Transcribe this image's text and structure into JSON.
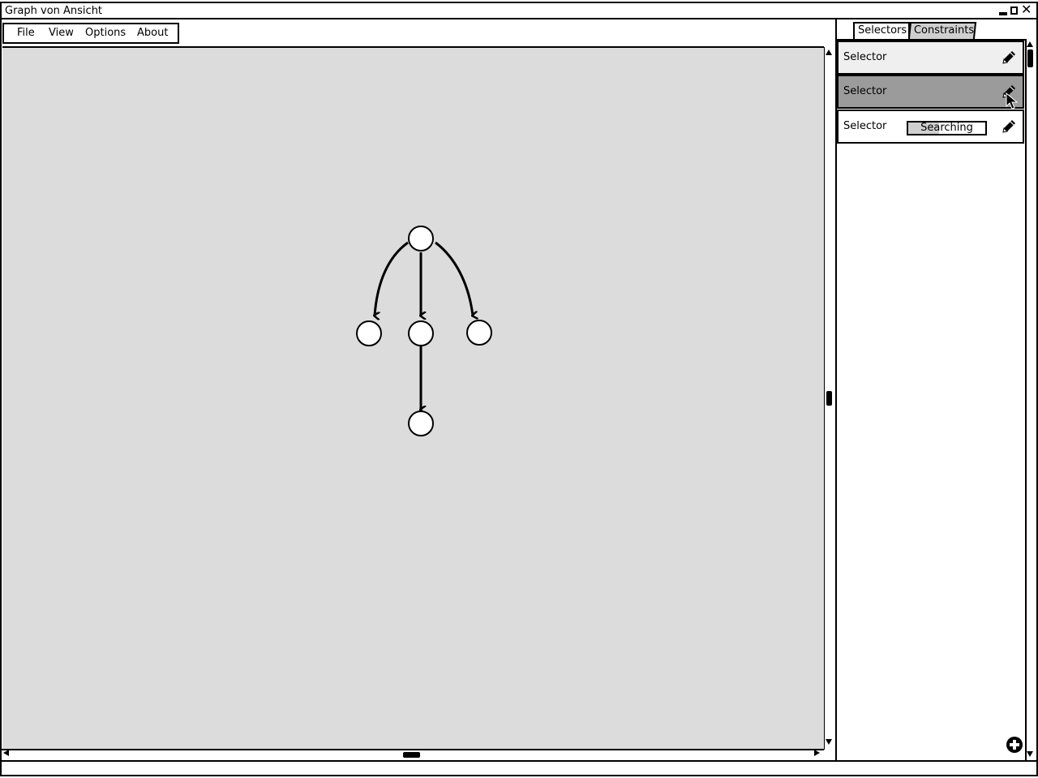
{
  "window": {
    "title": "Graph von Ansicht"
  },
  "menu": {
    "items": [
      "File",
      "View",
      "Options",
      "About"
    ]
  },
  "panel": {
    "tabs": [
      {
        "label": "Selectors",
        "active": true
      },
      {
        "label": "Constraints",
        "active": false
      }
    ],
    "selectors": [
      {
        "label": "Selector",
        "state": "normal",
        "action_icon": "pencil-icon"
      },
      {
        "label": "Selector",
        "state": "hovered",
        "action_icon": "pencil-icon"
      },
      {
        "label": "Selector",
        "state": "searching",
        "action_icon": "pencil-icon",
        "progress_label": "Searching",
        "progress": 0.4
      }
    ],
    "add_icon": "plus-circle-icon"
  },
  "graph": {
    "nodes": [
      "root",
      "left-child",
      "middle-child",
      "right-child",
      "grandchild"
    ],
    "edges": [
      [
        "root",
        "left-child"
      ],
      [
        "root",
        "middle-child"
      ],
      [
        "root",
        "right-child"
      ],
      [
        "middle-child",
        "grandchild"
      ]
    ]
  },
  "colors": {
    "canvas": "#dcdcdc",
    "selected_row": "#9b9b9b",
    "first_row": "#efefef",
    "inactive_tab": "#cfcfcf"
  }
}
